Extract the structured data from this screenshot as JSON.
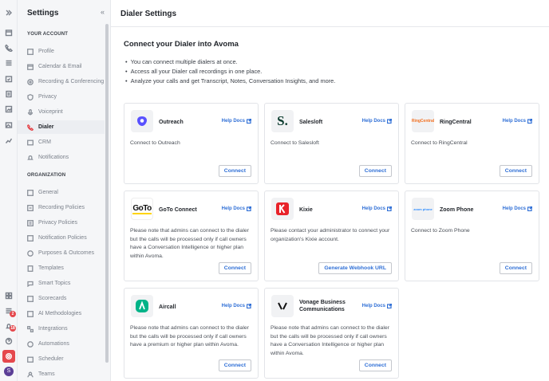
{
  "rail": {
    "badges": [
      "2",
      "18"
    ],
    "avatar": "S"
  },
  "sidebar": {
    "title": "Settings",
    "collapse": "«",
    "your_account": "YOUR ACCOUNT",
    "account_items": [
      "Profile",
      "Calendar & Email",
      "Recording & Conferencing",
      "Privacy",
      "Voiceprint",
      "Dialer",
      "CRM",
      "Notifications"
    ],
    "organization": "ORGANIZATION",
    "org_items": [
      "General",
      "Recording Policies",
      "Privacy Policies",
      "Notification Policies",
      "Purposes & Outcomes",
      "Templates",
      "Smart Topics",
      "Scorecards",
      "AI Methodologies",
      "Integrations",
      "Automations",
      "Scheduler",
      "Teams"
    ]
  },
  "header": {
    "title": "Dialer Settings"
  },
  "intro": {
    "title": "Connect your Dialer into Avoma",
    "bullets": [
      "You can connect multiple dialers at once.",
      "Access all your Dialer call recordings in one place.",
      "Analyze your calls and get Transcript, Notes, Conversation Insights, and more."
    ]
  },
  "help_docs": "Help Docs",
  "cards": [
    {
      "name": "Outreach",
      "desc": "Connect to Outreach",
      "button": "Connect"
    },
    {
      "name": "Salesloft",
      "desc": "Connect to Salesloft",
      "button": "Connect"
    },
    {
      "name": "RingCentral",
      "desc": "Connect to RingCentral",
      "button": "Connect"
    },
    {
      "name": "GoTo Connect",
      "desc": "Please note that admins can connect to the dialer but the calls will be processed only if call owners have a Conversation Intelligence or higher plan within Avoma.",
      "button": "Connect"
    },
    {
      "name": "Kixie",
      "desc": "Please contact your administrator to connect your organization's Kixie account.",
      "button": "Generate Webhook URL"
    },
    {
      "name": "Zoom Phone",
      "desc": "Connect to Zoom Phone",
      "button": "Connect"
    },
    {
      "name": "Aircall",
      "desc": "Please note that admins can connect to the dialer but the calls will be processed only if call owners have a premium or higher plan within Avoma.",
      "button": "Connect"
    },
    {
      "name": "Vonage Business Communications",
      "desc": "Please note that admins can connect to the dialer but the calls will be processed only if call owners have a Conversation Intelligence or higher plan within Avoma.",
      "button": "Connect"
    }
  ],
  "logos": {
    "salesloft": "S.",
    "ringcentral": "RingCentral",
    "goto": "GoTo",
    "zoom": "zoom phone"
  },
  "colors": {
    "accent": "#e5484d",
    "link": "#2f6fd6"
  }
}
